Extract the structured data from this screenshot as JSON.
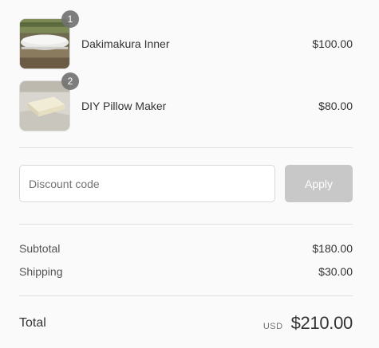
{
  "items": [
    {
      "name": "Dakimakura Inner",
      "price": "$100.00",
      "quantity": "1",
      "image": "white-pillow-photo"
    },
    {
      "name": "DIY Pillow Maker",
      "price": "$80.00",
      "quantity": "2",
      "image": "pillow-block-photo"
    }
  ],
  "discount": {
    "placeholder": "Discount code",
    "apply_label": "Apply"
  },
  "subtotal": {
    "label": "Subtotal",
    "value": "$180.00"
  },
  "shipping": {
    "label": "Shipping",
    "value": "$30.00"
  },
  "total": {
    "label": "Total",
    "currency": "USD",
    "value": "$210.00"
  },
  "colors": {
    "apply_disabled": "#c8c8c8",
    "badge": "#727272",
    "divider": "#e1e1e1",
    "background": "#fafafa"
  }
}
